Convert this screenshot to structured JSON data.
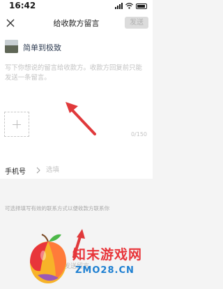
{
  "status_bar": {
    "time": "16:42"
  },
  "nav": {
    "title": "给收款方留言",
    "close_icon": "close-icon",
    "send_label": "发送"
  },
  "recipient": {
    "name": "简单到极致"
  },
  "message": {
    "placeholder": "写下你想说的留言给收款方。收款方回复前只能发送一条留言。",
    "counter": "0/150"
  },
  "add_photo": {
    "icon": "plus-icon"
  },
  "phone": {
    "label": "手机号",
    "placeholder": "选填",
    "hint": "可选择填写有效的联系方式以便收款方联系你"
  },
  "bottom": {
    "text": "发送留言"
  },
  "watermark": {
    "title": "知末游戏网",
    "url": "ZMO28.CN"
  },
  "colors": {
    "background": "#f4f4f4",
    "arrow": "#e0393b",
    "send_disabled": "#dcdcdc"
  }
}
